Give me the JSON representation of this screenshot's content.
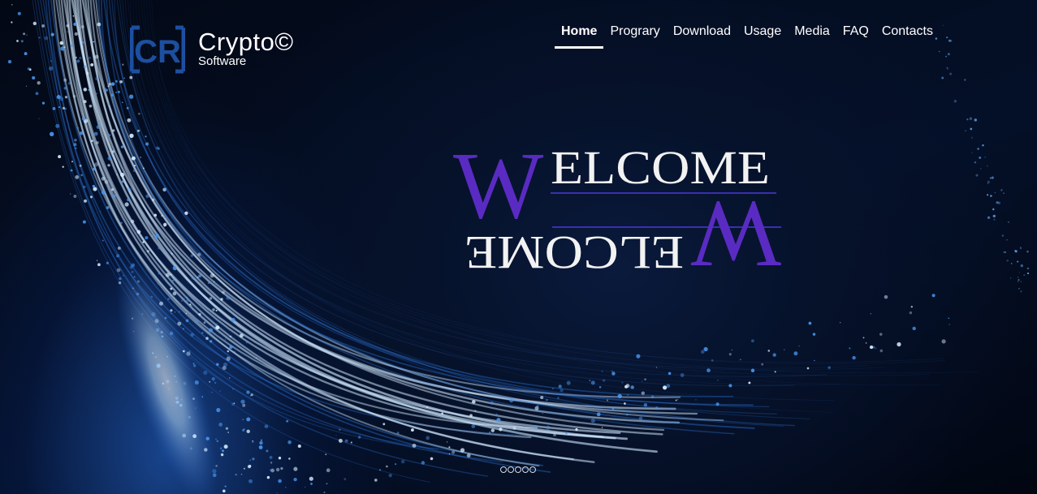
{
  "brand": {
    "logo_mark": "CR",
    "name": "Crypto©",
    "tagline": "Software",
    "logo_color": "#1c4fa0"
  },
  "nav": {
    "items": [
      {
        "label": "Home",
        "active": true
      },
      {
        "label": "Prograry",
        "active": false
      },
      {
        "label": "Download",
        "active": false
      },
      {
        "label": "Usage",
        "active": false
      },
      {
        "label": "Media",
        "active": false
      },
      {
        "label": "FAQ",
        "active": false
      },
      {
        "label": "Contacts",
        "active": false
      }
    ]
  },
  "hero": {
    "title_initial": "W",
    "title_rest": "ELCOME",
    "initial_color": "#5a2bc2",
    "text_color": "#f2f2f2",
    "background_art": "blue-particle-swirl"
  },
  "carousel": {
    "slide_count": 5,
    "active_index": 0
  }
}
